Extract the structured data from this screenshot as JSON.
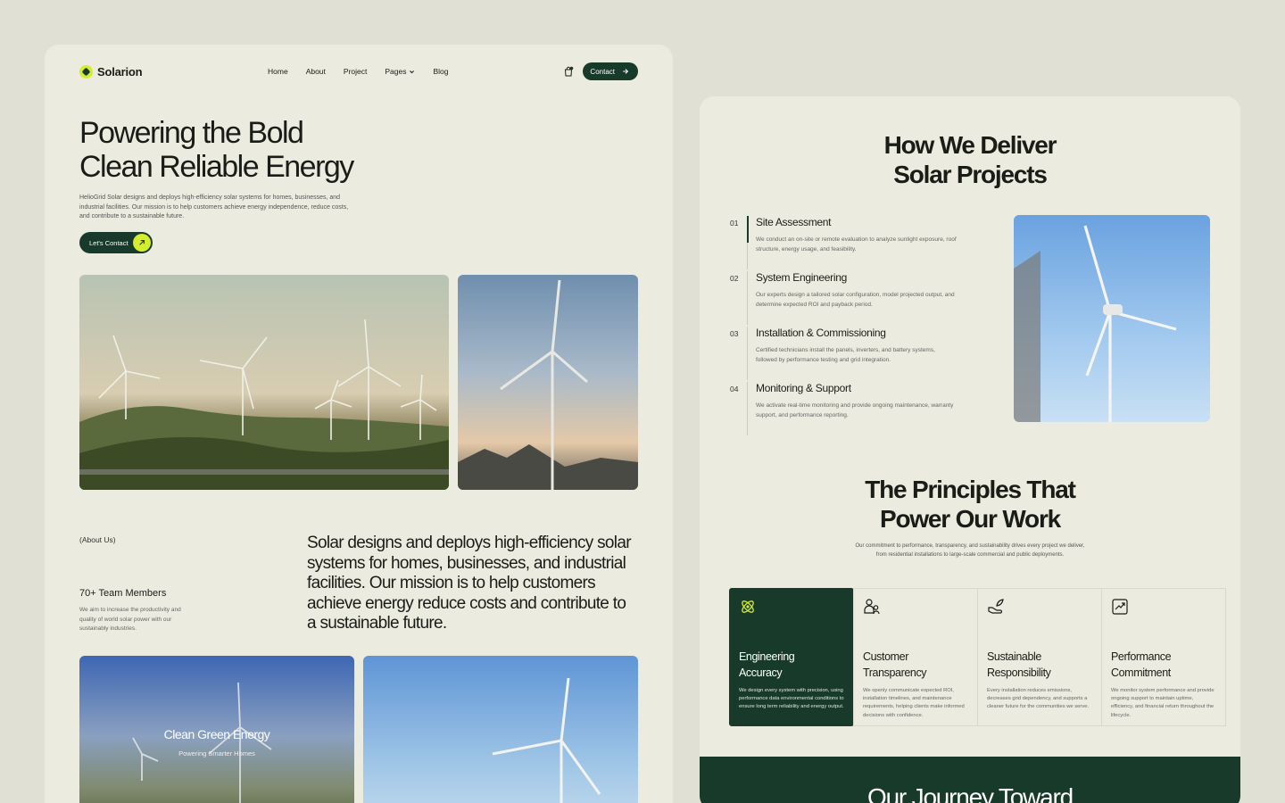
{
  "brand": {
    "name": "Solarion",
    "accent": "#d6ec2e",
    "primary": "#173a2b"
  },
  "nav": {
    "links": [
      "Home",
      "About",
      "Project",
      "Pages",
      "Blog"
    ],
    "contact_label": "Contact"
  },
  "hero": {
    "title_line1": "Powering the Bold",
    "title_line2": "Clean Reliable Energy",
    "description": "HelioGrid Solar designs and deploys high-efficiency solar systems for homes, businesses, and industrial facilities. Our mission is to help customers achieve energy independence, reduce costs, and contribute to a sustainable future.",
    "cta_label": "Let's Contact"
  },
  "about": {
    "tag": "(About Us)",
    "team_title": "70+ Team Members",
    "team_desc": "We aim to increase the productivity and quality of world solar power with our sustainably industries.",
    "statement": "Solar designs and deploys high-efficiency solar systems for homes, businesses, and industrial facilities. Our mission is to help customers achieve energy reduce costs and contribute to a sustainable future."
  },
  "promo": {
    "title": "Clean Green Energy",
    "subtitle": "Powering Smarter Homes"
  },
  "deliver": {
    "title_line1": "How We Deliver",
    "title_line2": "Solar Projects",
    "steps": [
      {
        "num": "01",
        "title": "Site Assessment",
        "desc": "We conduct an on-site or remote evaluation to analyze sunlight exposure, roof structure, energy usage, and feasibility."
      },
      {
        "num": "02",
        "title": "System Engineering",
        "desc": "Our experts design a tailored solar configuration, model projected output, and determine expected ROI and payback period."
      },
      {
        "num": "03",
        "title": "Installation & Commissioning",
        "desc": "Certified technicians install the panels, inverters, and battery systems, followed by performance testing and grid integration."
      },
      {
        "num": "04",
        "title": "Monitoring & Support",
        "desc": "We activate real-time monitoring and provide ongoing maintenance, warranty support, and performance reporting."
      }
    ]
  },
  "principles": {
    "title_line1": "The Principles That",
    "title_line2": "Power Our Work",
    "description": "Our commitment to performance, transparency, and sustainability drives every project we deliver, from residential installations to large-scale commercial and public deployments.",
    "cards": [
      {
        "icon": "atom-icon",
        "title": "Engineering Accuracy",
        "desc": "We design every system with precision, using performance data environmental conditions to ensure long term reliability and energy output."
      },
      {
        "icon": "users-icon",
        "title": "Customer Transparency",
        "desc": "We openly communicate expected ROI, installation timelines, and maintenance requirements, helping clients make informed decisions with confidence."
      },
      {
        "icon": "hand-leaf-icon",
        "title": "Sustainable Responsibility",
        "desc": "Every installation reduces emissions, decreases grid dependency, and supports a cleaner future for the communities we serve."
      },
      {
        "icon": "trend-up-icon",
        "title": "Performance Commitment",
        "desc": "We monitor system performance and provide ongoing support to maintain uptime, efficiency, and financial return throughout the lifecycle."
      }
    ]
  },
  "journey": {
    "title": "Our Journey Toward"
  }
}
